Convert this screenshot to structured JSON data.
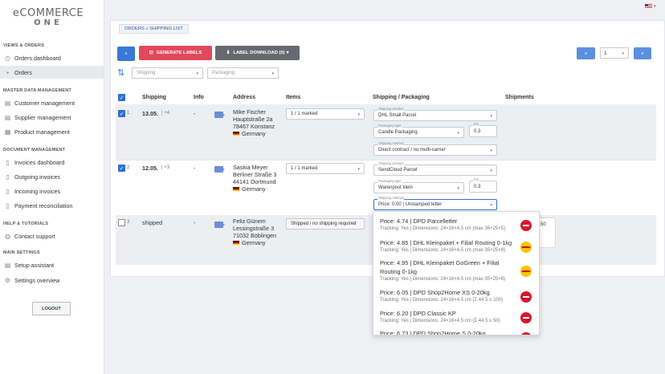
{
  "brand": {
    "line1": "eCOMMERCE",
    "line2": "ONE"
  },
  "sidebar": {
    "sections": [
      {
        "title": "VIEWS & ORDERS"
      },
      {
        "title": "MASTER DATA MANAGEMENT"
      },
      {
        "title": "DOCUMENT MANAGEMENT"
      },
      {
        "title": "HELP & TUTORIALS"
      },
      {
        "title": "MAIN SETTINGS"
      }
    ],
    "items": [
      {
        "label": "Orders dashboard",
        "icon": "dashboard-icon"
      },
      {
        "label": "Orders",
        "icon": "cart-icon"
      },
      {
        "label": "Customer management",
        "icon": "customer-icon"
      },
      {
        "label": "Supplier management",
        "icon": "supplier-icon"
      },
      {
        "label": "Product management",
        "icon": "product-icon"
      },
      {
        "label": "Invoices dashboard",
        "icon": "invoice-icon"
      },
      {
        "label": "Outgoing invoices",
        "icon": "outgoing-invoice-icon"
      },
      {
        "label": "Incoming invoices",
        "icon": "incoming-invoice-icon"
      },
      {
        "label": "Payment reconciliation",
        "icon": "payment-icon"
      },
      {
        "label": "Contact support",
        "icon": "support-icon"
      },
      {
        "label": "Setup assistant",
        "icon": "setup-icon"
      },
      {
        "label": "Settings overview",
        "icon": "settings-icon"
      }
    ],
    "logout": "LOGOUT"
  },
  "breadcrumb": "ORDERS » SHIPPING LIST",
  "toolbar": {
    "back": "«",
    "generate": "GENERATE LABELS",
    "download": "LABEL DOWNLOAD (0)",
    "download_caret": "▾",
    "page": "1",
    "page_caret": "▾",
    "first": "«",
    "next": "»"
  },
  "filters": {
    "sort_icon": "sort-icon",
    "shipping": "Shipping",
    "packaging": "Packaging"
  },
  "columns": [
    "Shipping",
    "Info",
    "Address",
    "Items",
    "Shipping / Packaging",
    "Shipments"
  ],
  "orders": [
    {
      "checked": true,
      "num": "1",
      "date": "13.05.",
      "extra": "| +4",
      "info": "-",
      "address": [
        "Mike Fischer",
        "Hauptstraße 2a",
        "78467 Konstanz",
        "Germany"
      ],
      "items": "1 / 1 marked",
      "product_label": "Shipping product",
      "product": "DHL Small Parcel",
      "packtype_label": "Packaging type",
      "packtype": "Candle Packaging",
      "kg_label": "KG",
      "kg": "0.3",
      "method_label": "Shipping method",
      "method": "Direct contract / no multi-carrier"
    },
    {
      "checked": true,
      "num": "2",
      "date": "12.05.",
      "extra": "| +3",
      "info": "-",
      "address": [
        "Saskia Meyer",
        "Berliner Straße 3",
        "44141 Dortmund",
        "Germany"
      ],
      "items": "1 / 1 marked",
      "product_label": "Shipping product",
      "product": "SendCloud Parcel",
      "packtype_label": "Packaging type",
      "packtype": "Warenpost klein",
      "kg_label": "KG",
      "kg": "0.3",
      "method_label": "Shipping method",
      "method": "Price: 0.00 | Unstamped letter"
    },
    {
      "checked": false,
      "num": "3",
      "date": "shipped",
      "info": "-",
      "address": [
        "Feliz Günem",
        "Lessingstraße 3",
        "71032 Böblingen",
        "Germany"
      ],
      "items": "Shipped / no shipping required"
    }
  ],
  "dropdown_options": [
    {
      "title": "Price: 4.74 | DPD Parcelletter",
      "sub": "Tracking: Yes | Dimensions: 24×16×4.5 cm (max 36×25×5)",
      "carrier": "dpd"
    },
    {
      "title": "Price: 4.85 | DHL Kleinpaket + Filial Routing 0-1kg",
      "sub": "Tracking: Yes | Dimensions: 24×16×4.5 cm (max 35×25×8)",
      "carrier": "dhl"
    },
    {
      "title": "Price: 4.95 | DHL Kleinpaket GoGreen + Filial Routing 0-1kg",
      "sub": "Tracking: Yes | Dimensions: 24×16×4.5 cm (max 35×25×8)",
      "carrier": "dhl"
    },
    {
      "title": "Price: 6.05 | DPD Shop2Home XS 0-20kg",
      "sub": "Tracking: Yes | Dimensions: 24×16×4.5 cm (Σ 44.5 ≤ 100)",
      "carrier": "dpd"
    },
    {
      "title": "Price: 6.20 | DPD Classic KP",
      "sub": "Tracking: Yes | Dimensions: 24×16×4.5 cm (Σ 44.5 ≤ 50)",
      "carrier": "dpd"
    },
    {
      "title": "Price: 6.73 | DPD Shop2Home S 0-20kg",
      "sub": "",
      "carrier": "dpd"
    }
  ],
  "peek": {
    "line1": "4.50",
    "line2": "0"
  },
  "colors": {
    "primary": "#3a78d8",
    "danger": "#e0485c",
    "dark": "#666a70",
    "dpd": "#d8162c",
    "dhl": "#f7c600"
  }
}
